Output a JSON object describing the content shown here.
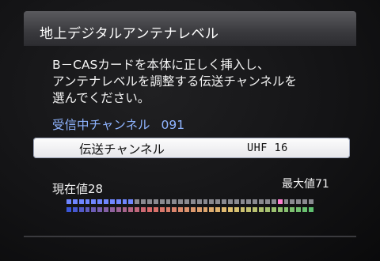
{
  "screen": {
    "title": "地上デジタルアンテナレベル",
    "description_lines": [
      "B－CASカードを本体に正しく挿入し、",
      "アンテナレベルを調整する伝送チャンネルを",
      "選んでください。"
    ],
    "receiving_label": "受信中チャンネル",
    "receiving_number": "091",
    "channel_selector": {
      "label": "伝送チャンネル",
      "value": "UHF 16"
    },
    "current_value_label": "現在値28",
    "max_value_label": "最大値71"
  },
  "meter": {
    "current": 28,
    "max": 71,
    "colors": {
      "current_fill": "#6f86ff",
      "max_marker": "#ff7fd0",
      "inactive": "#8a8a90",
      "bottom_gradient": [
        "#3a56d8",
        "#d86a6a",
        "#e0c070",
        "#5fc070"
      ]
    }
  }
}
